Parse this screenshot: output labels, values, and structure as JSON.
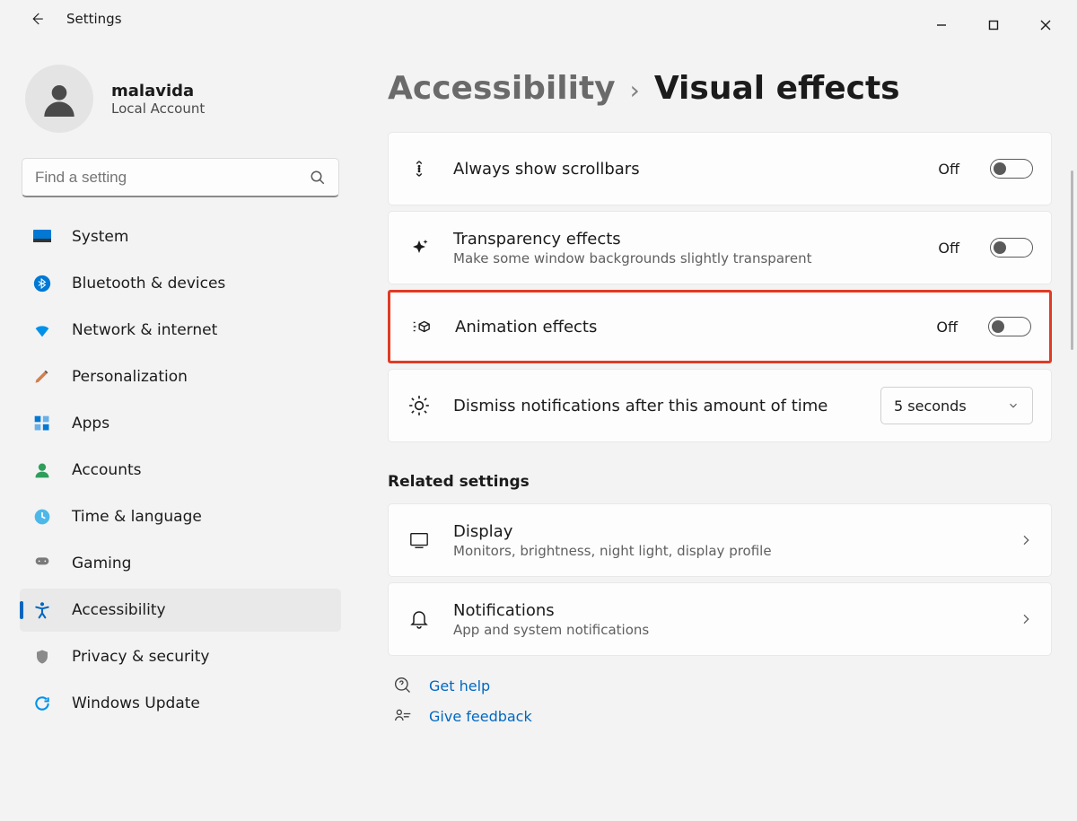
{
  "app": {
    "title": "Settings"
  },
  "account": {
    "name": "malavida",
    "sub": "Local Account"
  },
  "search": {
    "placeholder": "Find a setting"
  },
  "nav": {
    "items": [
      {
        "id": "system",
        "label": "System"
      },
      {
        "id": "bluetooth",
        "label": "Bluetooth & devices"
      },
      {
        "id": "network",
        "label": "Network & internet"
      },
      {
        "id": "personalization",
        "label": "Personalization"
      },
      {
        "id": "apps",
        "label": "Apps"
      },
      {
        "id": "accounts",
        "label": "Accounts"
      },
      {
        "id": "time",
        "label": "Time & language"
      },
      {
        "id": "gaming",
        "label": "Gaming"
      },
      {
        "id": "accessibility",
        "label": "Accessibility",
        "active": true
      },
      {
        "id": "privacy",
        "label": "Privacy & security"
      },
      {
        "id": "update",
        "label": "Windows Update"
      }
    ]
  },
  "breadcrumb": {
    "parent": "Accessibility",
    "current": "Visual effects"
  },
  "settings": {
    "scrollbars": {
      "title": "Always show scrollbars",
      "state": "Off"
    },
    "transparency": {
      "title": "Transparency effects",
      "sub": "Make some window backgrounds slightly transparent",
      "state": "Off"
    },
    "animation": {
      "title": "Animation effects",
      "state": "Off",
      "highlighted": true
    },
    "notifications": {
      "title": "Dismiss notifications after this amount of time",
      "value": "5 seconds"
    }
  },
  "related": {
    "heading": "Related settings",
    "display": {
      "title": "Display",
      "sub": "Monitors, brightness, night light, display profile"
    },
    "notifications": {
      "title": "Notifications",
      "sub": "App and system notifications"
    }
  },
  "footer": {
    "help": "Get help",
    "feedback": "Give feedback"
  }
}
